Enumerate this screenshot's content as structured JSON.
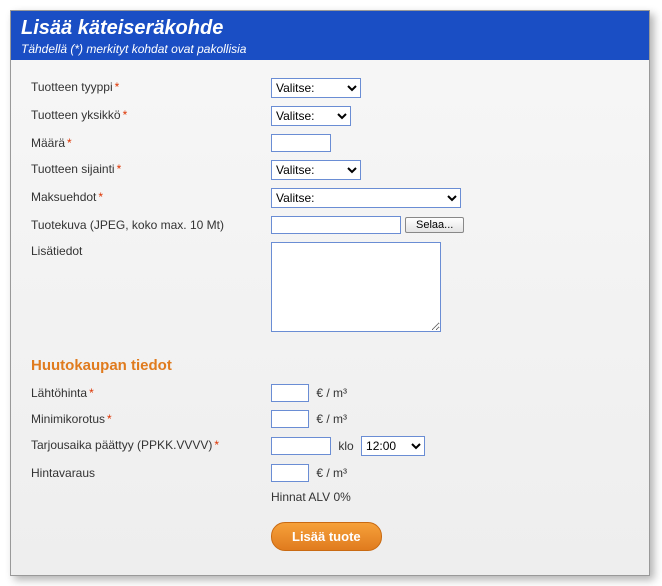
{
  "header": {
    "title": "Lisää käteiseräkohde",
    "subtitle_prefix": "Tähdellä (",
    "subtitle_mark": "*",
    "subtitle_suffix": ") merkityt kohdat ovat pakollisia"
  },
  "labels": {
    "product_type": "Tuotteen tyyppi",
    "product_unit": "Tuotteen yksikkö",
    "quantity": "Määrä",
    "product_location": "Tuotteen sijainti",
    "payment_terms": "Maksuehdot",
    "product_image": "Tuotekuva (JPEG, koko max. 10 Mt)",
    "additional_info": "Lisätiedot"
  },
  "select_placeholder": "Valitse:",
  "browse_label": "Selaa...",
  "section_auction": "Huutokaupan tiedot",
  "auction": {
    "start_price": "Lähtöhinta",
    "min_raise": "Minimikorotus",
    "bid_deadline": "Tarjousaika päättyy (PPKK.VVVV)",
    "price_reserve": "Hintavaraus",
    "unit": "€ / m³",
    "time_label": "klo",
    "time_value": "12:00",
    "vat_note": "Hinnat ALV 0%"
  },
  "submit_label": "Lisää tuote"
}
